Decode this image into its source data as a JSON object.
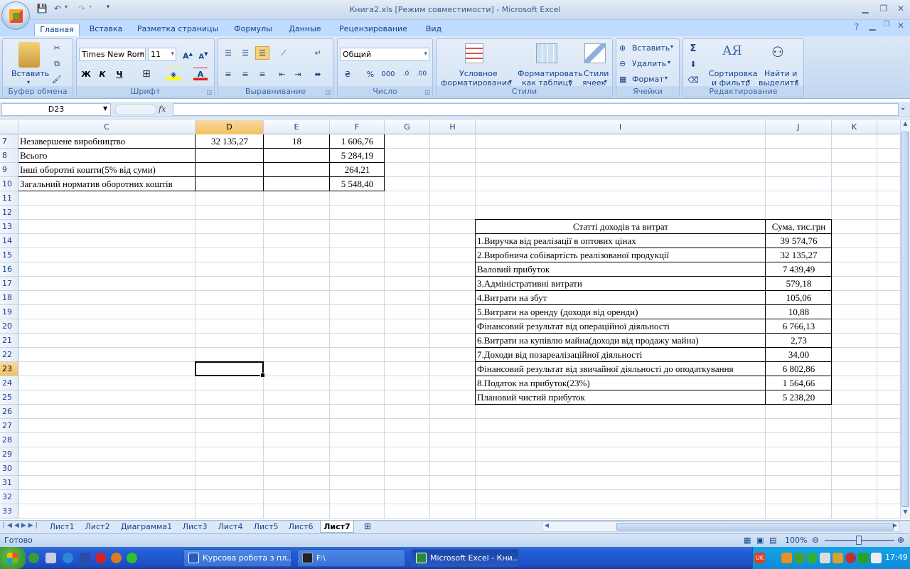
{
  "window": {
    "title": "Книга2.xls  [Режим совместимости] - Microsoft Excel"
  },
  "tabs": [
    "Главная",
    "Вставка",
    "Разметка страницы",
    "Формулы",
    "Данные",
    "Рецензирование",
    "Вид"
  ],
  "ribbon": {
    "clipboard": {
      "label": "Буфер обмена",
      "paste": "Вставить"
    },
    "font": {
      "label": "Шрифт",
      "name": "Times New Rom",
      "size": "11",
      "bold": "Ж",
      "italic": "К",
      "underline": "Ч"
    },
    "align": {
      "label": "Выравнивание"
    },
    "number": {
      "label": "Число",
      "format": "Общий"
    },
    "styles": {
      "label": "Стили",
      "cond1": "Условное",
      "cond2": "форматирование",
      "table1": "Форматировать",
      "table2": "как таблицу",
      "cell1": "Стили",
      "cell2": "ячеек"
    },
    "cells": {
      "label": "Ячейки",
      "insert": "Вставить",
      "delete": "Удалить",
      "format": "Формат"
    },
    "editing": {
      "label": "Редактирование",
      "sort1": "Сортировка",
      "sort2": "и фильтр",
      "find1": "Найти и",
      "find2": "выделить"
    }
  },
  "formula": {
    "namebox": "D23",
    "fx": "fx",
    "value": ""
  },
  "columns": [
    "C",
    "D",
    "E",
    "F",
    "G",
    "H",
    "I",
    "J",
    "K"
  ],
  "rows": [
    "7",
    "8",
    "9",
    "10",
    "11",
    "12",
    "13",
    "14",
    "15",
    "16",
    "17",
    "18",
    "19",
    "20",
    "21",
    "22",
    "23",
    "24",
    "25",
    "26",
    "27",
    "28",
    "29",
    "30",
    "31",
    "32",
    "33"
  ],
  "table1": [
    {
      "c": "Незавершене виробництво",
      "d": "32 135,27",
      "e": "18",
      "f": "1 606,76"
    },
    {
      "c": "Всього",
      "d": "",
      "e": "",
      "f": "5 284,19"
    },
    {
      "c": "Інші оборотні кошти(5% від суми)",
      "d": "",
      "e": "",
      "f": "264,21"
    },
    {
      "c": "Загальний норматив оборотних коштів",
      "d": "",
      "e": "",
      "f": "5 548,40"
    }
  ],
  "table2": {
    "header": {
      "i": "Статті доходів та витрат",
      "j": "Сума, тис.грн"
    },
    "rows": [
      {
        "i": "1.Виручка від реалізації в оптових цінах",
        "j": "39 574,76"
      },
      {
        "i": "2.Виробнича собівартість реалізованої продукції",
        "j": "32 135,27"
      },
      {
        "i": "Валовий прибуток",
        "j": "7 439,49"
      },
      {
        "i": "3.Адміністративні витрати",
        "j": "579,18"
      },
      {
        "i": "4.Витрати на збут",
        "j": "105,06"
      },
      {
        "i": "5.Витрати на оренду (доходи від оренди)",
        "j": "10,88"
      },
      {
        "i": "Фінансовий результат від операційної діяльності",
        "j": "6 766,13"
      },
      {
        "i": "6.Витрати на купівлю майна(доходи від продажу майна)",
        "j": "2,73"
      },
      {
        "i": "7.Доходи від позареалізаційної діяльності",
        "j": "34,00"
      },
      {
        "i": "Фінансовий результат від звичайної діяльності до оподаткування",
        "j": "6 802,86"
      },
      {
        "i": "8.Податок на прибуток(23%)",
        "j": "1 564,66"
      },
      {
        "i": "Плановий чистий прибуток",
        "j": "5 238,20"
      }
    ]
  },
  "sheets": [
    "Лист1",
    "Лист2",
    "Диаграмма1",
    "Лист3",
    "Лист4",
    "Лист5",
    "Лист6",
    "Лист7"
  ],
  "active_sheet": "Лист7",
  "status": {
    "ready": "Готово",
    "zoom": "100%"
  },
  "taskbar": {
    "items": [
      "Курсова робота з пл...",
      "F:\\",
      "Microsoft Excel - Кни..."
    ],
    "lang": "UK",
    "clock": "17:49"
  }
}
